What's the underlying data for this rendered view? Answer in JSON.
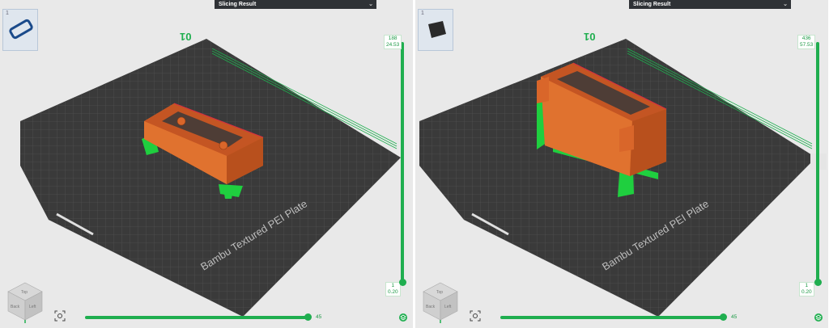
{
  "panels": [
    {
      "id": "left",
      "header": "Slicing Result",
      "plate_thumbnail_index": "1",
      "plate_label": "01",
      "plate_name": "Bambu Textured PEI Plate",
      "layer_top": "188",
      "layer_top_height": "24.53",
      "layer_bottom": "1",
      "layer_bottom_height": "0.20",
      "horizontal_value": "45",
      "horizontal_progress": 0.98,
      "view_cube": {
        "top": "Top",
        "left": "Left",
        "back": "Back"
      }
    },
    {
      "id": "right",
      "header": "Slicing Result",
      "plate_thumbnail_index": "1",
      "plate_label": "01",
      "plate_name": "Bambu Textured PEI Plate",
      "layer_top": "436",
      "layer_top_height": "57.53",
      "layer_bottom": "1",
      "layer_bottom_height": "0.20",
      "horizontal_value": "45",
      "horizontal_progress": 0.98,
      "view_cube": {
        "top": "Top",
        "left": "Left",
        "back": "Back"
      }
    }
  ],
  "icons": {
    "header_chevron": "chevron-down-icon",
    "layer_icon": "layers-icon",
    "fit_icon": "fit-view-icon"
  },
  "colors": {
    "bed": "#3a3a3a",
    "grid": "#5d5d5d",
    "model": "#d9662a",
    "model_shade": "#b8501d",
    "support": "#1fcf3f",
    "accent": "#1fae4f",
    "header_bg": "#2f3236"
  }
}
